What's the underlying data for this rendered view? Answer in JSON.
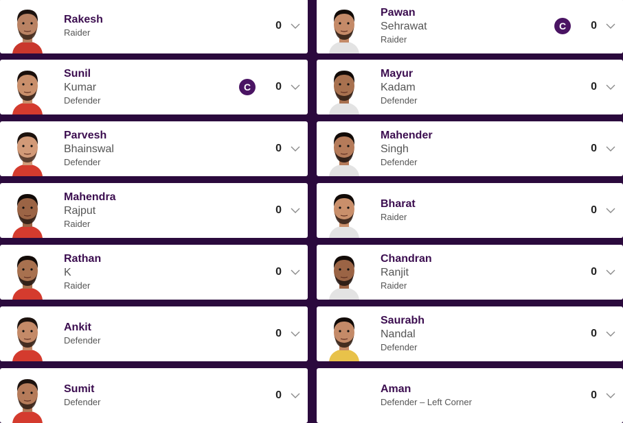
{
  "left": [
    {
      "first": "Rakesh",
      "last": "",
      "role": "Raider",
      "points": "0",
      "captain": false,
      "jersey": "#c9372c",
      "skin": "#b98263",
      "hair": "#1c120e",
      "beard": "#3a2418"
    },
    {
      "first": "Sunil",
      "last": "Kumar",
      "role": "Defender",
      "points": "0",
      "captain": true,
      "captain_label": "C",
      "jersey": "#d43b2e",
      "skin": "#c98f6b",
      "hair": "#1a0f0b",
      "beard": "#2e1c14"
    },
    {
      "first": "Parvesh",
      "last": "Bhainswal",
      "role": "Defender",
      "points": "0",
      "captain": false,
      "jersey": "#d43b2e",
      "skin": "#d29a78",
      "hair": "#1c120e",
      "beard": "#4a3024"
    },
    {
      "first": "Mahendra",
      "last": "Rajput",
      "role": "Raider",
      "points": "0",
      "captain": false,
      "jersey": "#d43b2e",
      "skin": "#9b6445",
      "hair": "#120b08",
      "beard": "#2a1a12"
    },
    {
      "first": "Rathan",
      "last": "K",
      "role": "Raider",
      "points": "0",
      "captain": false,
      "jersey": "#d43b2e",
      "skin": "#a8714f",
      "hair": "#120b08",
      "beard": "#1c120e"
    },
    {
      "first": "Ankit",
      "last": "",
      "role": "Defender",
      "points": "0",
      "captain": false,
      "jersey": "#d43b2e",
      "skin": "#c48a68",
      "hair": "#1c120e",
      "beard": "#2e1c14"
    },
    {
      "first": "Sumit",
      "last": "",
      "role": "Defender",
      "points": "0",
      "captain": false,
      "jersey": "#d43b2e",
      "skin": "#b57b5a",
      "hair": "#1c120e",
      "beard": "#2e1c14"
    }
  ],
  "right": [
    {
      "first": "Pawan",
      "last": "Sehrawat",
      "role": "Raider",
      "points": "0",
      "captain": true,
      "captain_label": "C",
      "jersey": "#e3e3e3",
      "skin": "#c48a68",
      "hair": "#120b08",
      "beard": "#2a1a12"
    },
    {
      "first": "Mayur",
      "last": "Kadam",
      "role": "Defender",
      "points": "0",
      "captain": false,
      "jersey": "#e3e3e3",
      "skin": "#a8714f",
      "hair": "#120b08",
      "beard": "#2a1a12"
    },
    {
      "first": "Mahender",
      "last": "Singh",
      "role": "Defender",
      "points": "0",
      "captain": false,
      "jersey": "#e3e3e3",
      "skin": "#b57b5a",
      "hair": "#120b08",
      "beard": "#1c120e"
    },
    {
      "first": "Bharat",
      "last": "",
      "role": "Raider",
      "points": "0",
      "captain": false,
      "jersey": "#e3e3e3",
      "skin": "#c98f6b",
      "hair": "#120b08",
      "beard": "#2e1c14"
    },
    {
      "first": "Chandran",
      "last": "Ranjit",
      "role": "Raider",
      "points": "0",
      "captain": false,
      "jersey": "#e3e3e3",
      "skin": "#9b6445",
      "hair": "#120b08",
      "beard": "#1c120e"
    },
    {
      "first": "Saurabh",
      "last": "Nandal",
      "role": "Defender",
      "points": "0",
      "captain": false,
      "jersey": "#e8c24a",
      "skin": "#c48a68",
      "hair": "#120b08",
      "beard": "#2e1c14"
    },
    {
      "first": "Aman",
      "last": "",
      "role": "Defender – Left Corner",
      "points": "0",
      "captain": false,
      "no_photo": true
    }
  ],
  "icons": {
    "chevron": "chevron-down-icon",
    "avatar": "player-avatar",
    "captain": "captain-badge"
  }
}
